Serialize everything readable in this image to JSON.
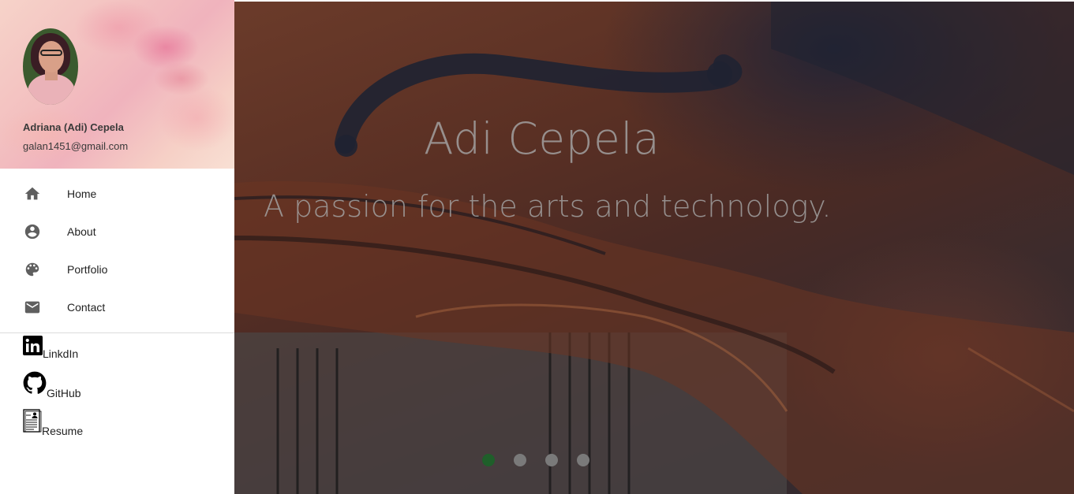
{
  "profile": {
    "name": "Adriana (Adi) Cepela",
    "email": "galan1451@gmail.com"
  },
  "nav": {
    "items": [
      {
        "label": "Home",
        "icon": "home-icon"
      },
      {
        "label": "About",
        "icon": "account-circle-icon"
      },
      {
        "label": "Portfolio",
        "icon": "palette-icon"
      },
      {
        "label": "Contact",
        "icon": "mail-icon"
      }
    ]
  },
  "social": {
    "linkedin": {
      "label": "LinkdIn",
      "icon": "linkedin-icon"
    },
    "github": {
      "label": "GitHub",
      "icon": "github-icon"
    },
    "resume": {
      "label": "Resume",
      "icon": "resume-icon"
    }
  },
  "hero": {
    "title": "Adi Cepela",
    "subtitle": "A passion for the arts and technology.",
    "slides_total": 4,
    "active_slide": 1
  },
  "colors": {
    "active_dot": "#1f5f2a",
    "inactive_dot": "#7a7a7a",
    "icon": "#5f5f5f"
  }
}
